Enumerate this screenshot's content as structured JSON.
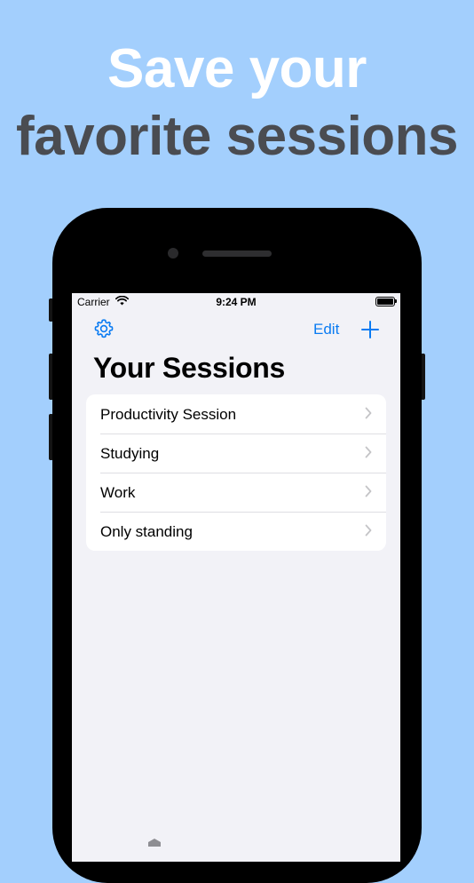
{
  "promo": {
    "line1": "Save your",
    "line2": "favorite sessions"
  },
  "status_bar": {
    "carrier": "Carrier",
    "time": "9:24 PM"
  },
  "nav": {
    "settings_icon": "gear-icon",
    "edit_label": "Edit",
    "add_icon": "plus-icon"
  },
  "page": {
    "title": "Your Sessions"
  },
  "sessions": [
    {
      "label": "Productivity Session"
    },
    {
      "label": "Studying"
    },
    {
      "label": "Work"
    },
    {
      "label": "Only standing"
    }
  ],
  "colors": {
    "background": "#a3cffd",
    "headline_white": "#ffffff",
    "headline_dark": "#4a4c51",
    "accent": "#0a7bf2",
    "screen_bg": "#f2f2f7"
  }
}
